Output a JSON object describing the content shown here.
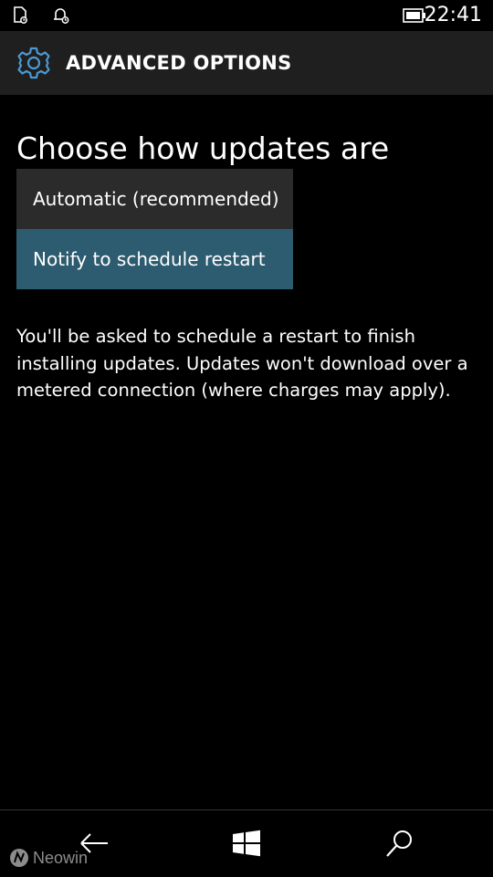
{
  "status_bar": {
    "time": "22:41",
    "icons": [
      "document-settings-icon",
      "notification-settings-icon",
      "battery-icon"
    ]
  },
  "header": {
    "title": "ADVANCED OPTIONS",
    "icon": "gear-icon",
    "accent_color": "#4a9ad4"
  },
  "main": {
    "heading": "Choose how updates are",
    "options": [
      {
        "label": "Automatic (recommended)",
        "selected": false
      },
      {
        "label": "Notify to schedule restart",
        "selected": true
      }
    ],
    "description": "You'll be asked to schedule a restart to finish installing updates. Updates won't download over a metered connection (where charges may apply)."
  },
  "nav_bar": {
    "buttons": [
      "back-arrow-icon",
      "windows-logo-icon",
      "search-icon"
    ]
  },
  "watermark": {
    "text": "Neowin"
  },
  "colors": {
    "background": "#000000",
    "header_bg": "#1f1f1f",
    "option_bg": "#2b2b2b",
    "selected_option_bg": "#2d5c70"
  }
}
